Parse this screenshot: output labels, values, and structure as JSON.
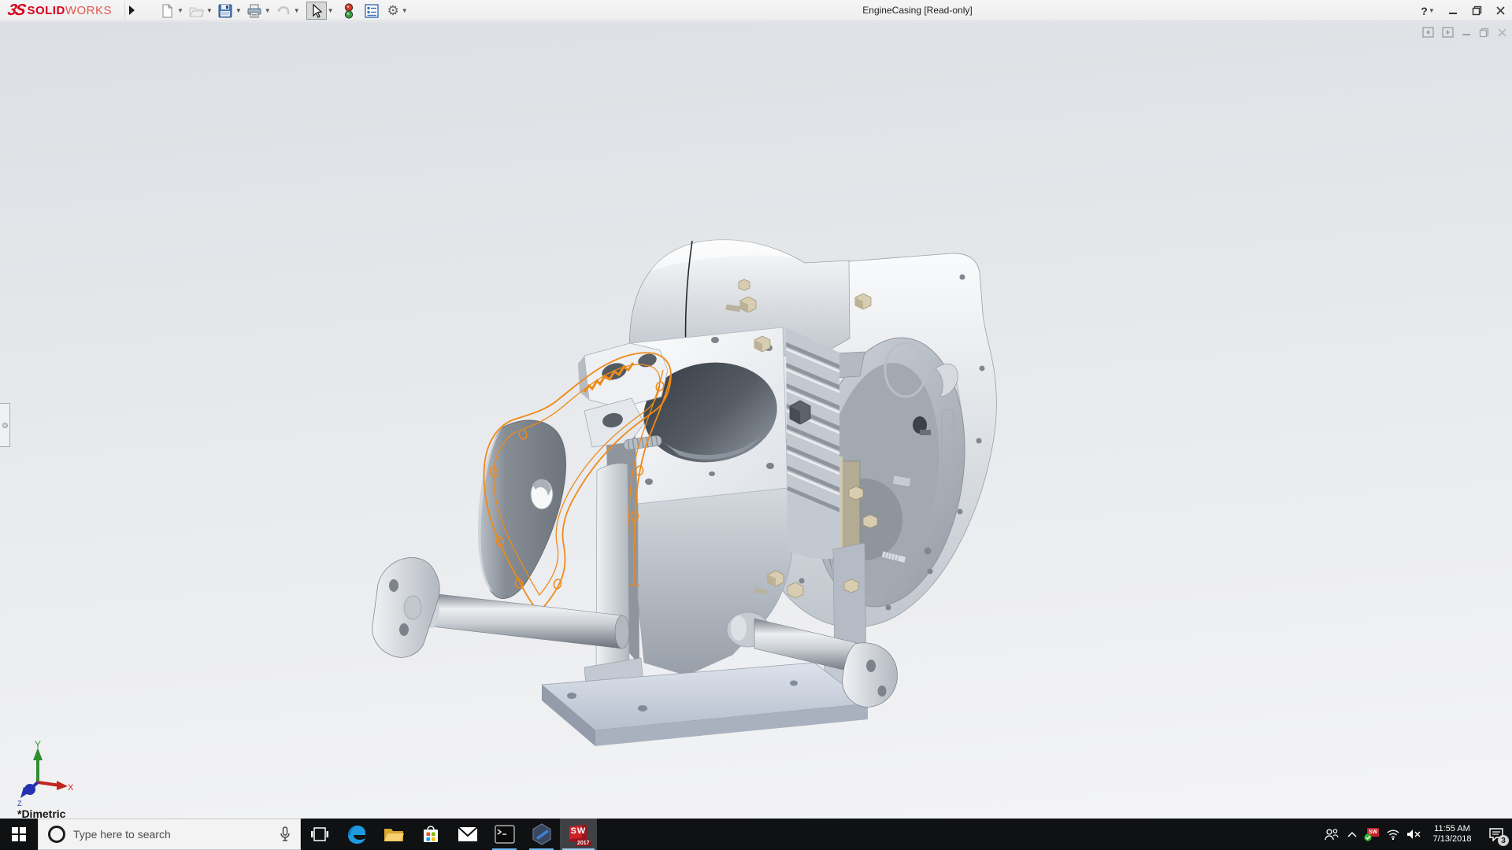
{
  "window": {
    "title": "EngineCasing [Read-only]",
    "help_label": "?"
  },
  "brand": {
    "mark": "3S",
    "name_bold": "SOLID",
    "name_light": "WORKS"
  },
  "toolbar": {
    "icons": [
      "new-document",
      "open",
      "save",
      "print",
      "undo",
      "select-arrow",
      "rebuild-traffic-light",
      "options-list",
      "settings-gear"
    ]
  },
  "viewport": {
    "orientation_label": "*Dimetric",
    "triad": {
      "x_label": "X",
      "y_label": "Y",
      "z_label": "Z"
    },
    "model_name": "engine-casing-assembly",
    "selection_color": "#ee8a18"
  },
  "taskbar": {
    "search_placeholder": "Type here to search",
    "time": "11:55 AM",
    "date": "7/13/2018",
    "notification_badge": "3",
    "sw_icon_text": "SW",
    "sw_icon_year": "2017",
    "sw_tray_text": "SW"
  },
  "colors": {
    "brand_red": "#d6001c",
    "selection_orange": "#ee8a18",
    "taskbar_bg": "#0f1113",
    "running_underline": "#6cb8f0"
  }
}
